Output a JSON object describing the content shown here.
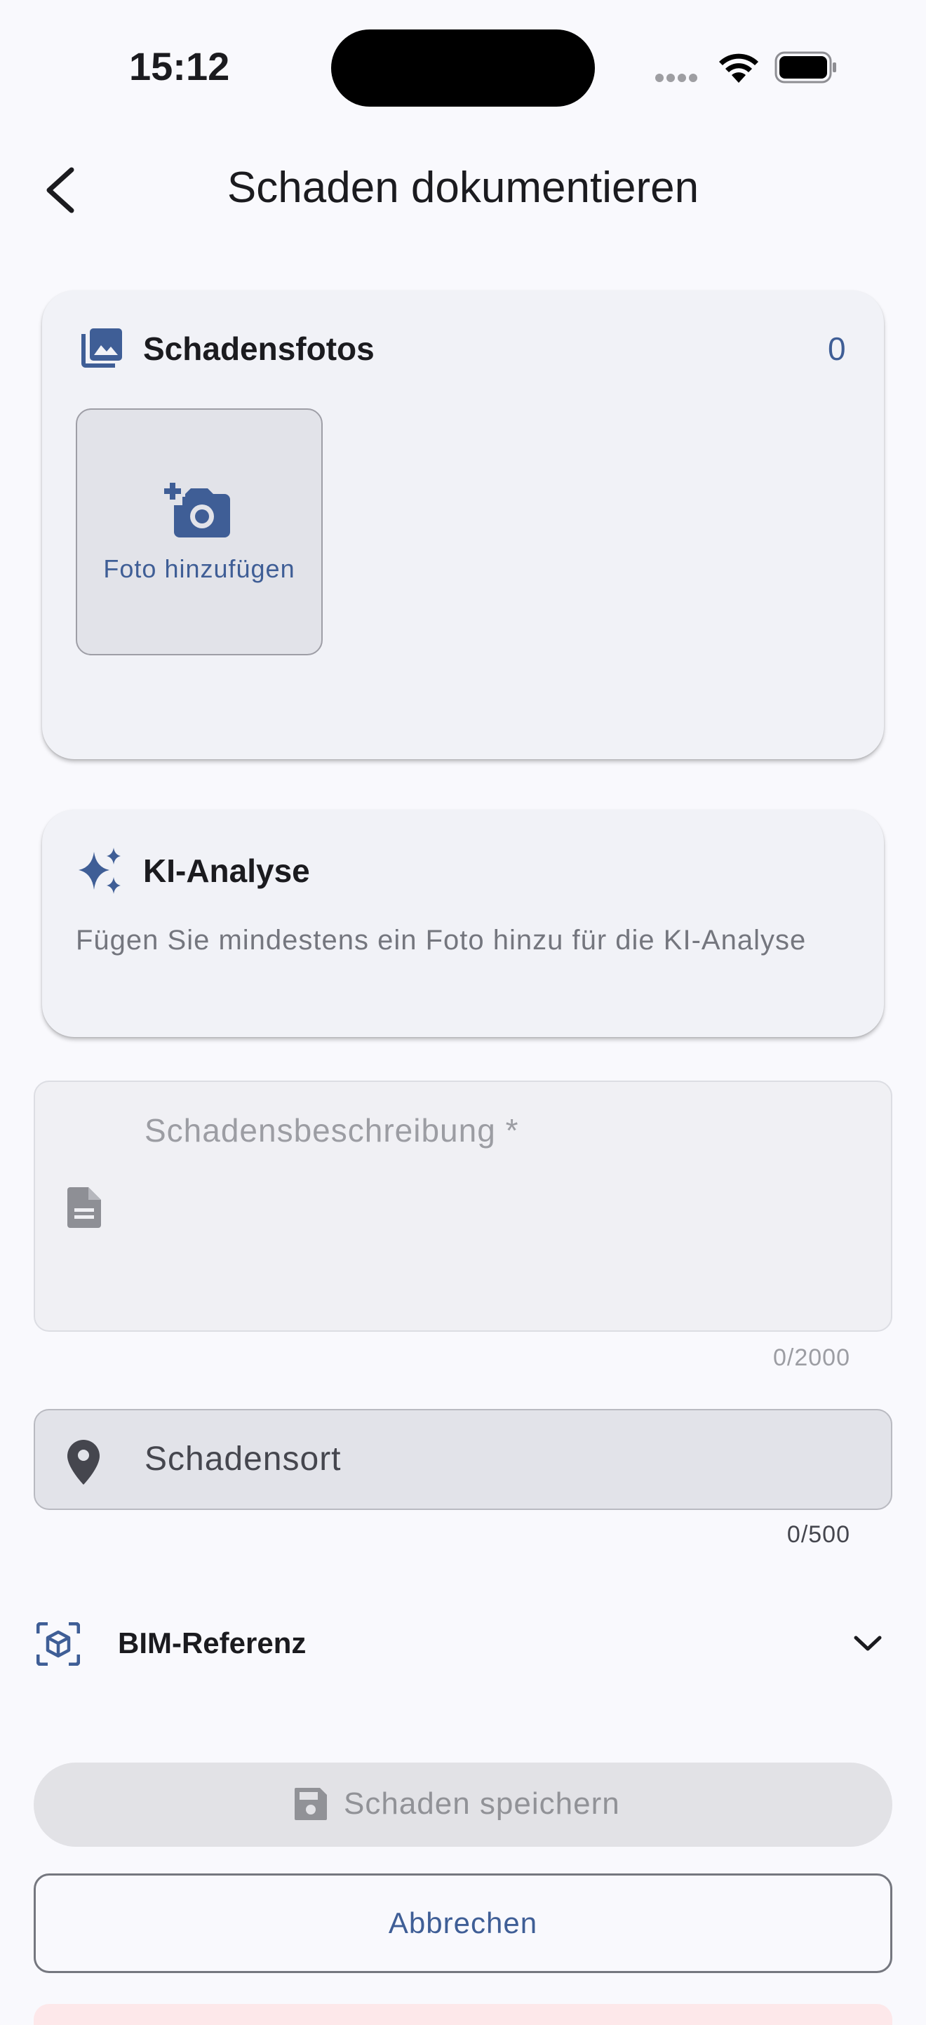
{
  "status_bar": {
    "time": "15:12"
  },
  "app_bar": {
    "title": "Schaden dokumentieren"
  },
  "photos_card": {
    "title": "Schadensfotos",
    "count": "0",
    "add_photo_label": "Foto hinzufügen"
  },
  "ki_card": {
    "title": "KI-Analyse",
    "hint": "Fügen Sie mindestens ein Foto hinzu für die KI-Analyse"
  },
  "description_field": {
    "placeholder": "Schadensbeschreibung *",
    "counter": "0/2000"
  },
  "location_field": {
    "placeholder": "Schadensort",
    "counter": "0/500"
  },
  "bim_row": {
    "label": "BIM-Referenz"
  },
  "actions": {
    "save_label": "Schaden speichern",
    "cancel_label": "Abbrechen"
  },
  "colors": {
    "primary": "#3f5e96",
    "background": "#f9f9fd",
    "card": "#f1f2f7"
  },
  "icons": {
    "back": "arrow-back-icon",
    "photos": "photo-library-icon",
    "add_photo": "add-a-photo-icon",
    "ki": "sparkle-icon",
    "description": "document-icon",
    "location": "location-pin-icon",
    "bim": "view-in-ar-icon",
    "expand": "chevron-down-icon",
    "save": "floppy-disk-icon"
  }
}
